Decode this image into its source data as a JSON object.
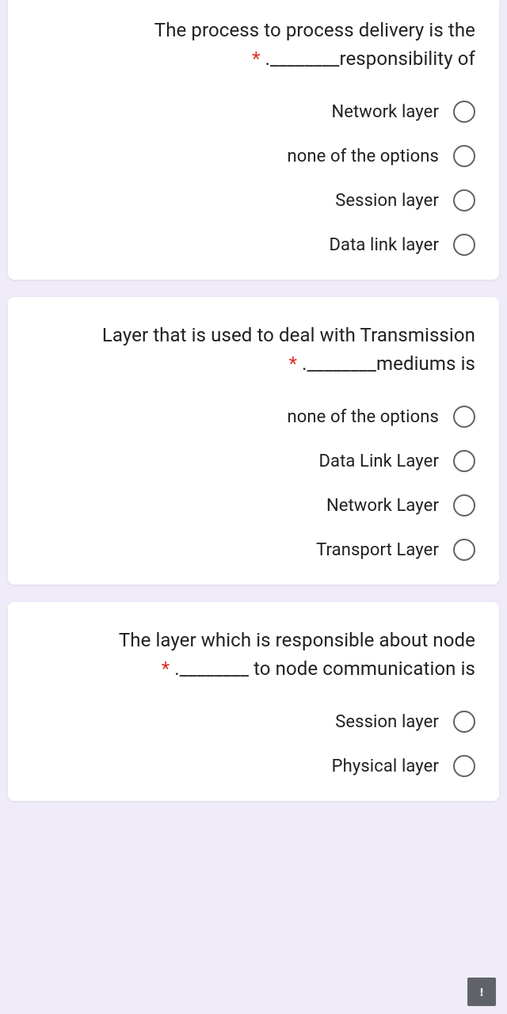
{
  "asterisk": "*",
  "questions": [
    {
      "text_line1": "The process to process delivery is the",
      "text_line2": ".________responsibility of",
      "options": [
        "Network layer",
        "none of the options",
        "Session layer",
        "Data link layer"
      ]
    },
    {
      "text_line1": "Layer that is used to deal with Transmission",
      "text_line2": ".________mediums is",
      "options": [
        "none of the options",
        "Data Link Layer",
        "Network Layer",
        "Transport Layer"
      ]
    },
    {
      "text_line1": "The layer which is responsible about node",
      "text_line2": ".________ to node communication is",
      "options": [
        "Session layer",
        "Physical layer"
      ]
    }
  ]
}
